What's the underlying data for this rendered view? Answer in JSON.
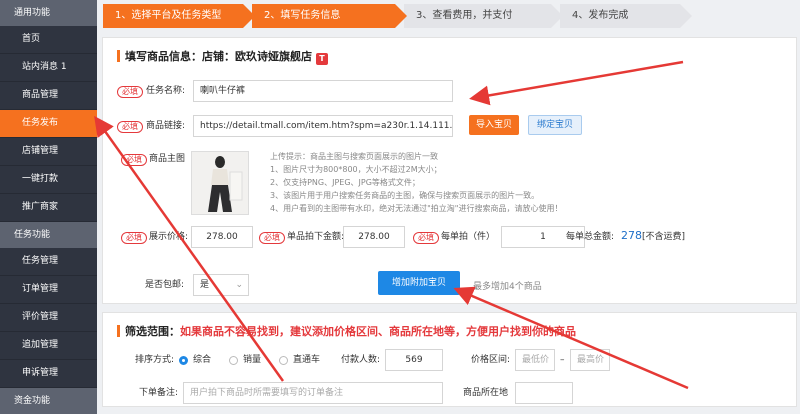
{
  "sidebar": {
    "groups": [
      {
        "title": "通用功能",
        "items": [
          "首页",
          "站内消息 1",
          "商品管理",
          "任务发布",
          "店铺管理",
          "一键打款",
          "推广商家"
        ]
      },
      {
        "title": "任务功能",
        "items": [
          "任务管理",
          "订单管理",
          "评价管理",
          "追加管理",
          "申诉管理"
        ]
      },
      {
        "title": "资金功能"
      }
    ],
    "active_item": "任务发布"
  },
  "steps": [
    "1、选择平台及任务类型",
    "2、填写任务信息",
    "3、查看费用，并支付",
    "4、发布完成"
  ],
  "goods": {
    "title": "填写商品信息：店铺：欧玖诗娅旗舰店",
    "required_tag": "必填",
    "task_name_label": "任务名称:",
    "task_name_value": "喇叭牛仔裤",
    "link_label": "商品链接:",
    "link_value": "https://detail.tmall.com/item.htm?spm=a230r.1.14.111.57025265mAln",
    "import_button": "导入宝贝",
    "bind_button": "绑定宝贝",
    "main_image_label": "商品主图",
    "tips": [
      "上传提示：商品主图与搜索页面展示的图片一致",
      "1、图片尺寸为800*800，大小不超过2M大小；",
      "2、仅支持PNG、JPEG、JPG等格式文件；",
      "3、该图片用于用户搜索任务商品的主图，确保与搜索页面展示的图片一致。",
      "4、用户看到的主图带有水印，绝对无法通过\"拍立淘\"进行搜索商品，请放心使用！"
    ],
    "price_label": "展示价格:",
    "price_value": "278.00",
    "order_price_label": "单品拍下金额:",
    "order_price_value": "278.00",
    "per_order_label": "每单拍（件）",
    "per_order_value": "1",
    "total_label": "每单总金额:",
    "total_value": "278",
    "shipping_note": "[不含运费]",
    "free_shipping_label": "是否包邮:",
    "free_shipping_value": "是",
    "add_button": "增加附加宝贝",
    "add_note": "最多增加4个商品"
  },
  "filter": {
    "title_prefix": "筛选范围：",
    "title_text": "如果商品不容易找到，建议添加价格区间、商品所在地等，方便用户找到你的商品",
    "sort_label": "排序方式:",
    "sort_options": [
      "综合",
      "销量",
      "直通车"
    ],
    "sort_selected": "综合",
    "payers_label": "付款人数:",
    "payers_value": "569",
    "price_range_label": "价格区间:",
    "min_price_placeholder": "最低价",
    "max_price_placeholder": "最高价",
    "range_sep": "–",
    "order_note_label": "下单备注:",
    "order_note_placeholder": "用户拍下商品时所需要填写的订单备注",
    "location_label": "商品所在地"
  },
  "colors": {
    "accent": "#f5711f",
    "sidebar_bg": "#2f3440",
    "required_red": "#e4393c",
    "primary_blue": "#1e88e5",
    "annotation_red": "#e53935"
  }
}
